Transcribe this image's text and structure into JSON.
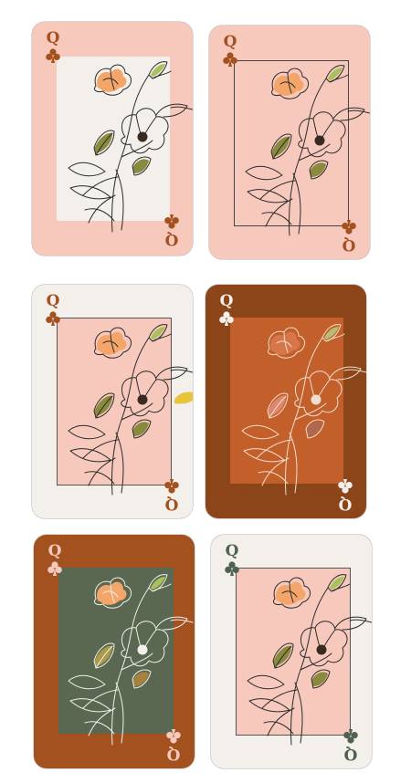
{
  "rank": "Q",
  "suit_icon": "club-icon",
  "colors": {
    "blush": "#f7c9bd",
    "cream": "#f3efeb",
    "rust": "#a3521f",
    "rust_dark": "#8b4518",
    "rust_mid": "#c35f2b",
    "sage": "#5a6852",
    "orange_flower": "#f4a66a",
    "leaf_olive": "#8a8a3e",
    "leaf_green": "#a9c15a",
    "yellow": "#e8c43a"
  },
  "cards": [
    {
      "id": "card-1",
      "variant": "blush frame, cream panel"
    },
    {
      "id": "card-2",
      "variant": "blush card, outlined panel"
    },
    {
      "id": "card-3",
      "variant": "cream frame, blush panel"
    },
    {
      "id": "card-4",
      "variant": "rust frame, rust panel"
    },
    {
      "id": "card-5",
      "variant": "rust frame, sage panel"
    },
    {
      "id": "card-6",
      "variant": "cream frame, blush panel, green index"
    }
  ]
}
